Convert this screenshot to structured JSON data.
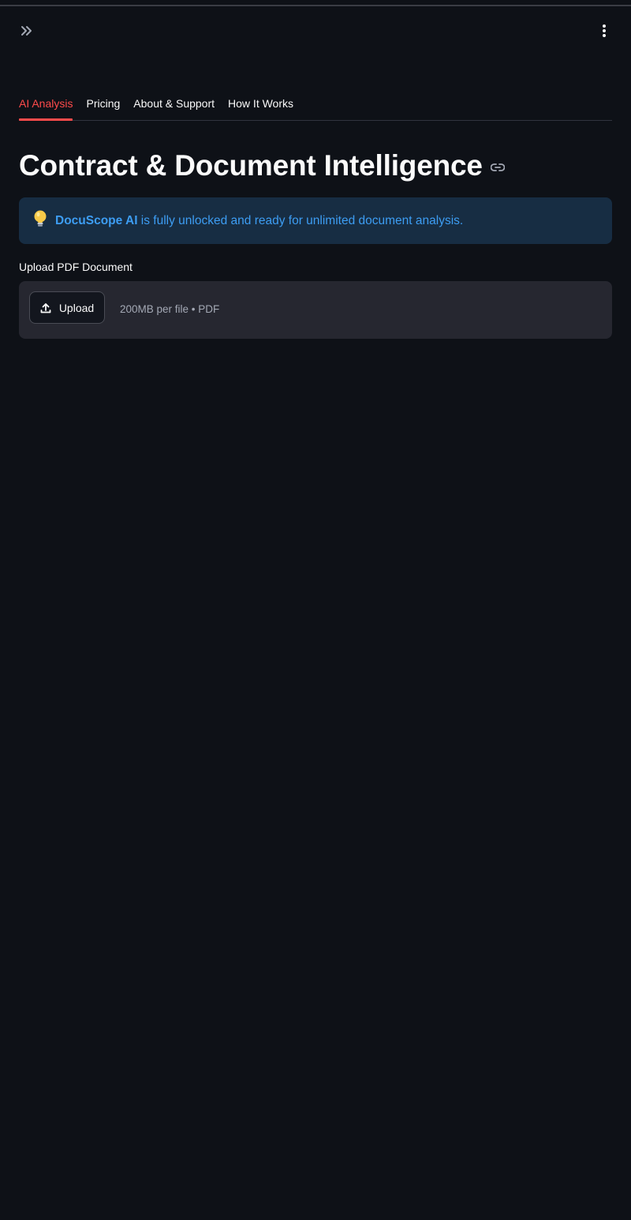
{
  "header": {
    "expand_icon": "double-chevron-right-icon",
    "menu_icon": "vertical-dots-icon"
  },
  "tabs": [
    {
      "label": "AI Analysis",
      "active": true
    },
    {
      "label": "Pricing",
      "active": false
    },
    {
      "label": "About & Support",
      "active": false
    },
    {
      "label": "How It Works",
      "active": false
    }
  ],
  "main": {
    "title": "Contract & Document Intelligence",
    "title_anchor_icon": "link-icon"
  },
  "info": {
    "icon": "lightbulb-icon",
    "brand": "DocuScope AI",
    "message": " is fully unlocked and ready for unlimited document analysis."
  },
  "uploader": {
    "label": "Upload PDF Document",
    "button_label": "Upload",
    "button_icon": "upload-icon",
    "hint": "200MB per file • PDF"
  },
  "colors": {
    "background": "#0e1117",
    "accent": "#ff4b4b",
    "info_background": "#172d43",
    "info_text": "#3d9df3",
    "dropzone": "#262730"
  }
}
